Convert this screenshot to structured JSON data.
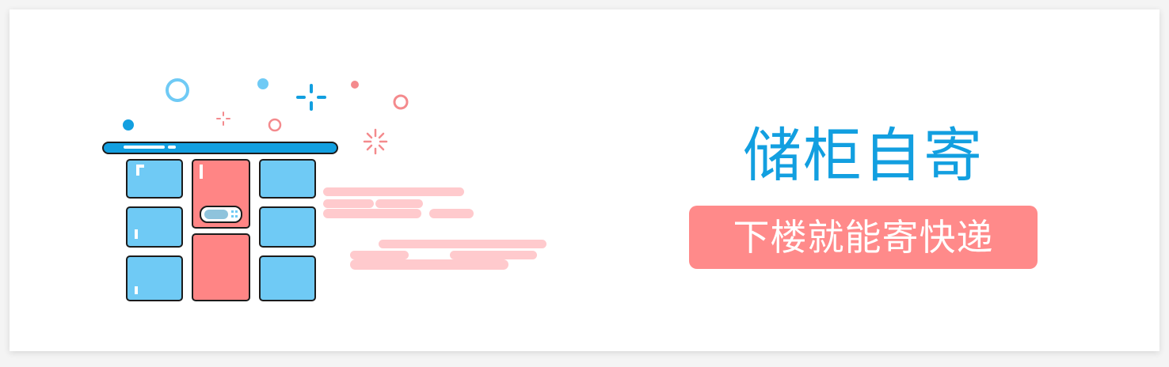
{
  "banner": {
    "title": "储柜自寄",
    "cta_label": "下楼就能寄快递"
  },
  "illustration": {
    "icon": "parcel-locker-icon",
    "decorations": [
      "sparkle-icon",
      "circle-icon",
      "dot-icon",
      "speed-lines"
    ]
  },
  "colors": {
    "title": "#129fe0",
    "cta_background": "#ff8a8a",
    "cta_text": "#ffffff",
    "locker_blue": "#6fcaf5",
    "locker_red": "#ff8585",
    "locker_top": "#129fe0",
    "speed_lines": "#ffcacd"
  }
}
